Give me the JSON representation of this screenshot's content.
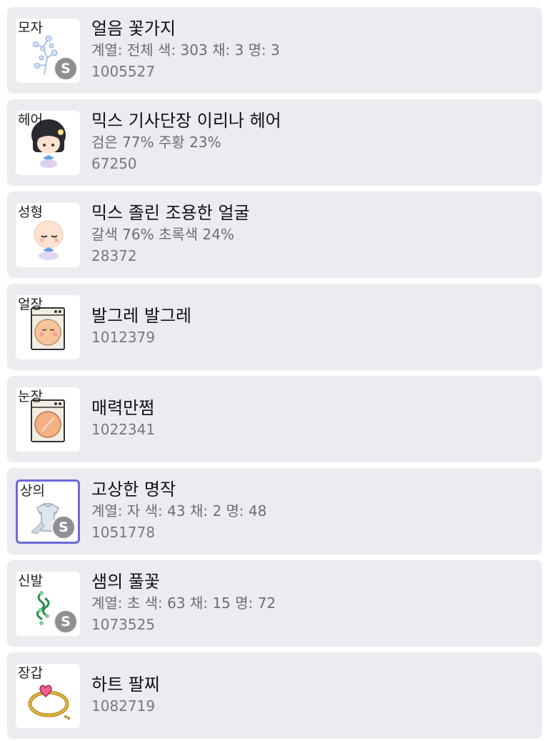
{
  "items": [
    {
      "slot": "모자",
      "name": "얼음 꽃가지",
      "detail": "계열: 전체 색: 303 채: 3 명: 3",
      "code": "1005527",
      "badge": "S",
      "icon": "ice-flower-branch-icon"
    },
    {
      "slot": "헤어",
      "name": "믹스 기사단장 이리나 헤어",
      "detail": "검은 77% 주황 23%",
      "code": "67250",
      "icon": "hair-preview-icon"
    },
    {
      "slot": "성형",
      "name": "믹스 졸린 조용한 얼굴",
      "detail": "갈색 76% 초록색 24%",
      "code": "28372",
      "icon": "face-preview-icon"
    },
    {
      "slot": "얼장",
      "name": "발그레 발그레",
      "code": "1012379",
      "icon": "face-accessory-icon"
    },
    {
      "slot": "눈장",
      "name": "매력만쩜",
      "code": "1022341",
      "icon": "eye-accessory-icon"
    },
    {
      "slot": "상의",
      "name": "고상한 명작",
      "detail": "계열: 자 색: 43 채: 2 명: 48",
      "code": "1051778",
      "badge": "S",
      "icon": "outfit-icon"
    },
    {
      "slot": "신발",
      "name": "샘의 풀꽃",
      "detail": "계열: 초 색: 63 채: 15 명: 72",
      "code": "1073525",
      "badge": "S",
      "icon": "grass-flower-shoes-icon"
    },
    {
      "slot": "장갑",
      "name": "하트 팔찌",
      "code": "1082719",
      "icon": "heart-bracelet-icon"
    }
  ],
  "colors": {
    "card_bg": "#ebebf0",
    "badge_bg": "#8e8e93",
    "selected_border": "#6d6ad8"
  }
}
